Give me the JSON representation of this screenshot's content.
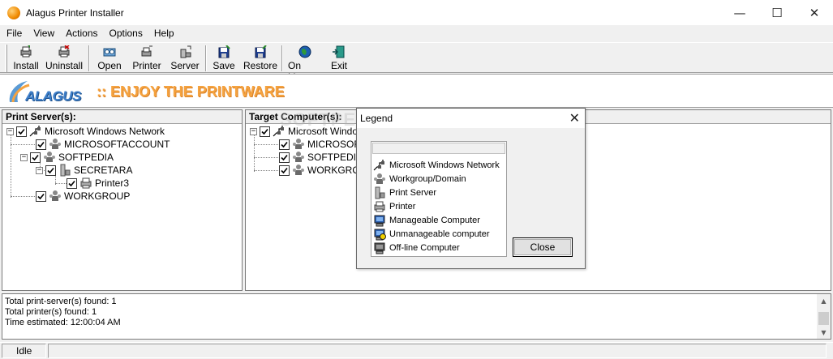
{
  "window": {
    "title": "Alagus Printer Installer",
    "minimize_glyph": "—",
    "maximize_glyph": "☐",
    "close_glyph": "✕"
  },
  "menu": [
    "File",
    "View",
    "Actions",
    "Options",
    "Help"
  ],
  "toolbar": {
    "install": "Install",
    "uninstall": "Uninstall",
    "open": "Open",
    "printer": "Printer",
    "server": "Server",
    "save": "Save",
    "restore": "Restore",
    "online": "On Line",
    "exit": "Exit"
  },
  "banner": {
    "logo": "ALAGUS",
    "slogan": ":: ENJOY THE PRINTWARE"
  },
  "left_panel": {
    "header": "Print Server(s):",
    "nodes": [
      {
        "label": "Microsoft Windows Network",
        "icon": "network-icon",
        "checked": true
      },
      {
        "label": "MICROSOFTACCOUNT",
        "icon": "workgroup-icon",
        "checked": true
      },
      {
        "label": "SOFTPEDIA",
        "icon": "workgroup-icon",
        "checked": true
      },
      {
        "label": "SECRETARA",
        "icon": "print-server-icon",
        "checked": true
      },
      {
        "label": "Printer3",
        "icon": "printer-icon",
        "checked": true
      },
      {
        "label": "WORKGROUP",
        "icon": "workgroup-icon",
        "checked": true
      }
    ]
  },
  "right_panel": {
    "header": "Target Computer(s):",
    "nodes": [
      {
        "label": "Microsoft Windows Network",
        "icon": "network-icon",
        "checked": true
      },
      {
        "label": "MICROSOFTACCOUNT",
        "icon": "workgroup-icon",
        "checked": true
      },
      {
        "label": "SOFTPEDIA",
        "icon": "workgroup-icon",
        "checked": true
      },
      {
        "label": "WORKGROUP",
        "icon": "workgroup-icon",
        "checked": true
      }
    ]
  },
  "log": {
    "lines": [
      "Total print-server(s) found: 1",
      "Total printer(s) found: 1",
      "Time estimated: 12:00:04 AM"
    ]
  },
  "status": {
    "state": "Idle"
  },
  "legend_dialog": {
    "title": "Legend",
    "items": [
      {
        "label": "Microsoft Windows Network",
        "icon": "network-icon"
      },
      {
        "label": "Workgroup/Domain",
        "icon": "workgroup-icon"
      },
      {
        "label": "Print Server",
        "icon": "print-server-icon"
      },
      {
        "label": "Printer",
        "icon": "printer-icon"
      },
      {
        "label": "Manageable Computer",
        "icon": "manageable-computer-icon"
      },
      {
        "label": "Unmanageable computer",
        "icon": "unmanageable-computer-icon"
      },
      {
        "label": "Off-line Computer",
        "icon": "offline-computer-icon"
      }
    ],
    "close_button": "Close"
  },
  "watermark": "SOFTPEDIA",
  "colors": {
    "logo_blue": "#3f7fc9",
    "slogan_orange": "#f5a340",
    "window_bg": "#f0f0f0"
  }
}
